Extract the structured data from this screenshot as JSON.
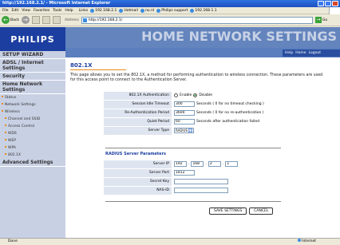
{
  "window": {
    "title": "http://192.168.2.1/ - Microsoft Internet Explorer"
  },
  "menu": {
    "items": [
      "File",
      "Edit",
      "View",
      "Favorites",
      "Tools",
      "Help"
    ],
    "links_label": "Links",
    "links": [
      "192.168.2.1",
      "Hotmail",
      "nu.nl",
      "Philips support",
      "192.168.1.1"
    ]
  },
  "toolbar": {
    "back_label": "Back",
    "address_label": "Address",
    "address_value": "http://192.168.2.1/",
    "go_label": "Go"
  },
  "header": {
    "logo": "PHILIPS",
    "banner": "HOME NETWORK SETTINGS",
    "help": "Help",
    "home": "Home",
    "logout": "Logout"
  },
  "sidebar": {
    "setup_wizard": "SETUP WIZARD",
    "adsl": "ADSL / Internet Settings",
    "security": "Security",
    "home_network": "Home Network Settings",
    "status": "Status",
    "network_settings": "Network Settings",
    "wireless": "Wireless",
    "channel_ssid": "Channel and SSID",
    "access_control": "Access Control",
    "wds": "WDS",
    "wep": "WEP",
    "wpa": "WPA",
    "x8021": "802.1X",
    "advanced": "Advanced Settings"
  },
  "main": {
    "title": "802.1X",
    "description": "This page allows you to set the 802.1X, a method for performing authentication to wireless connection. These parameters are used for this access point to connect to the Authentication Server.",
    "auth_label": "802.1X Authentication",
    "enable_label": "Enable",
    "disable_label": "Disable",
    "session_label": "Session Idle Timeout",
    "session_value": "300",
    "session_hint": "Seconds ( 0 for no timeout checking )",
    "reauth_label": "Re-Authentication Period",
    "reauth_value": "3600",
    "reauth_hint": "Seconds ( 0 for no re-authentication )",
    "quiet_label": "Quiet Period",
    "quiet_value": "60",
    "quiet_hint": "Seconds after authentication failed",
    "server_type_label": "Server Type",
    "server_type_value": "RADIUS",
    "radius_title": "RADIUS Server Parameters",
    "server_ip_label": "Server IP",
    "ip1": "192",
    "ip2": "168",
    "ip3": "2",
    "ip4": "1",
    "server_port_label": "Server Port",
    "server_port_value": "1812",
    "secret_key_label": "Secret Key",
    "secret_key_value": "",
    "nas_id_label": "NAS-ID",
    "nas_id_value": "",
    "save_label": "SAVE SETTINGS",
    "cancel_label": "CANCEL"
  },
  "status": {
    "left": "Done",
    "zone": "Internet"
  }
}
